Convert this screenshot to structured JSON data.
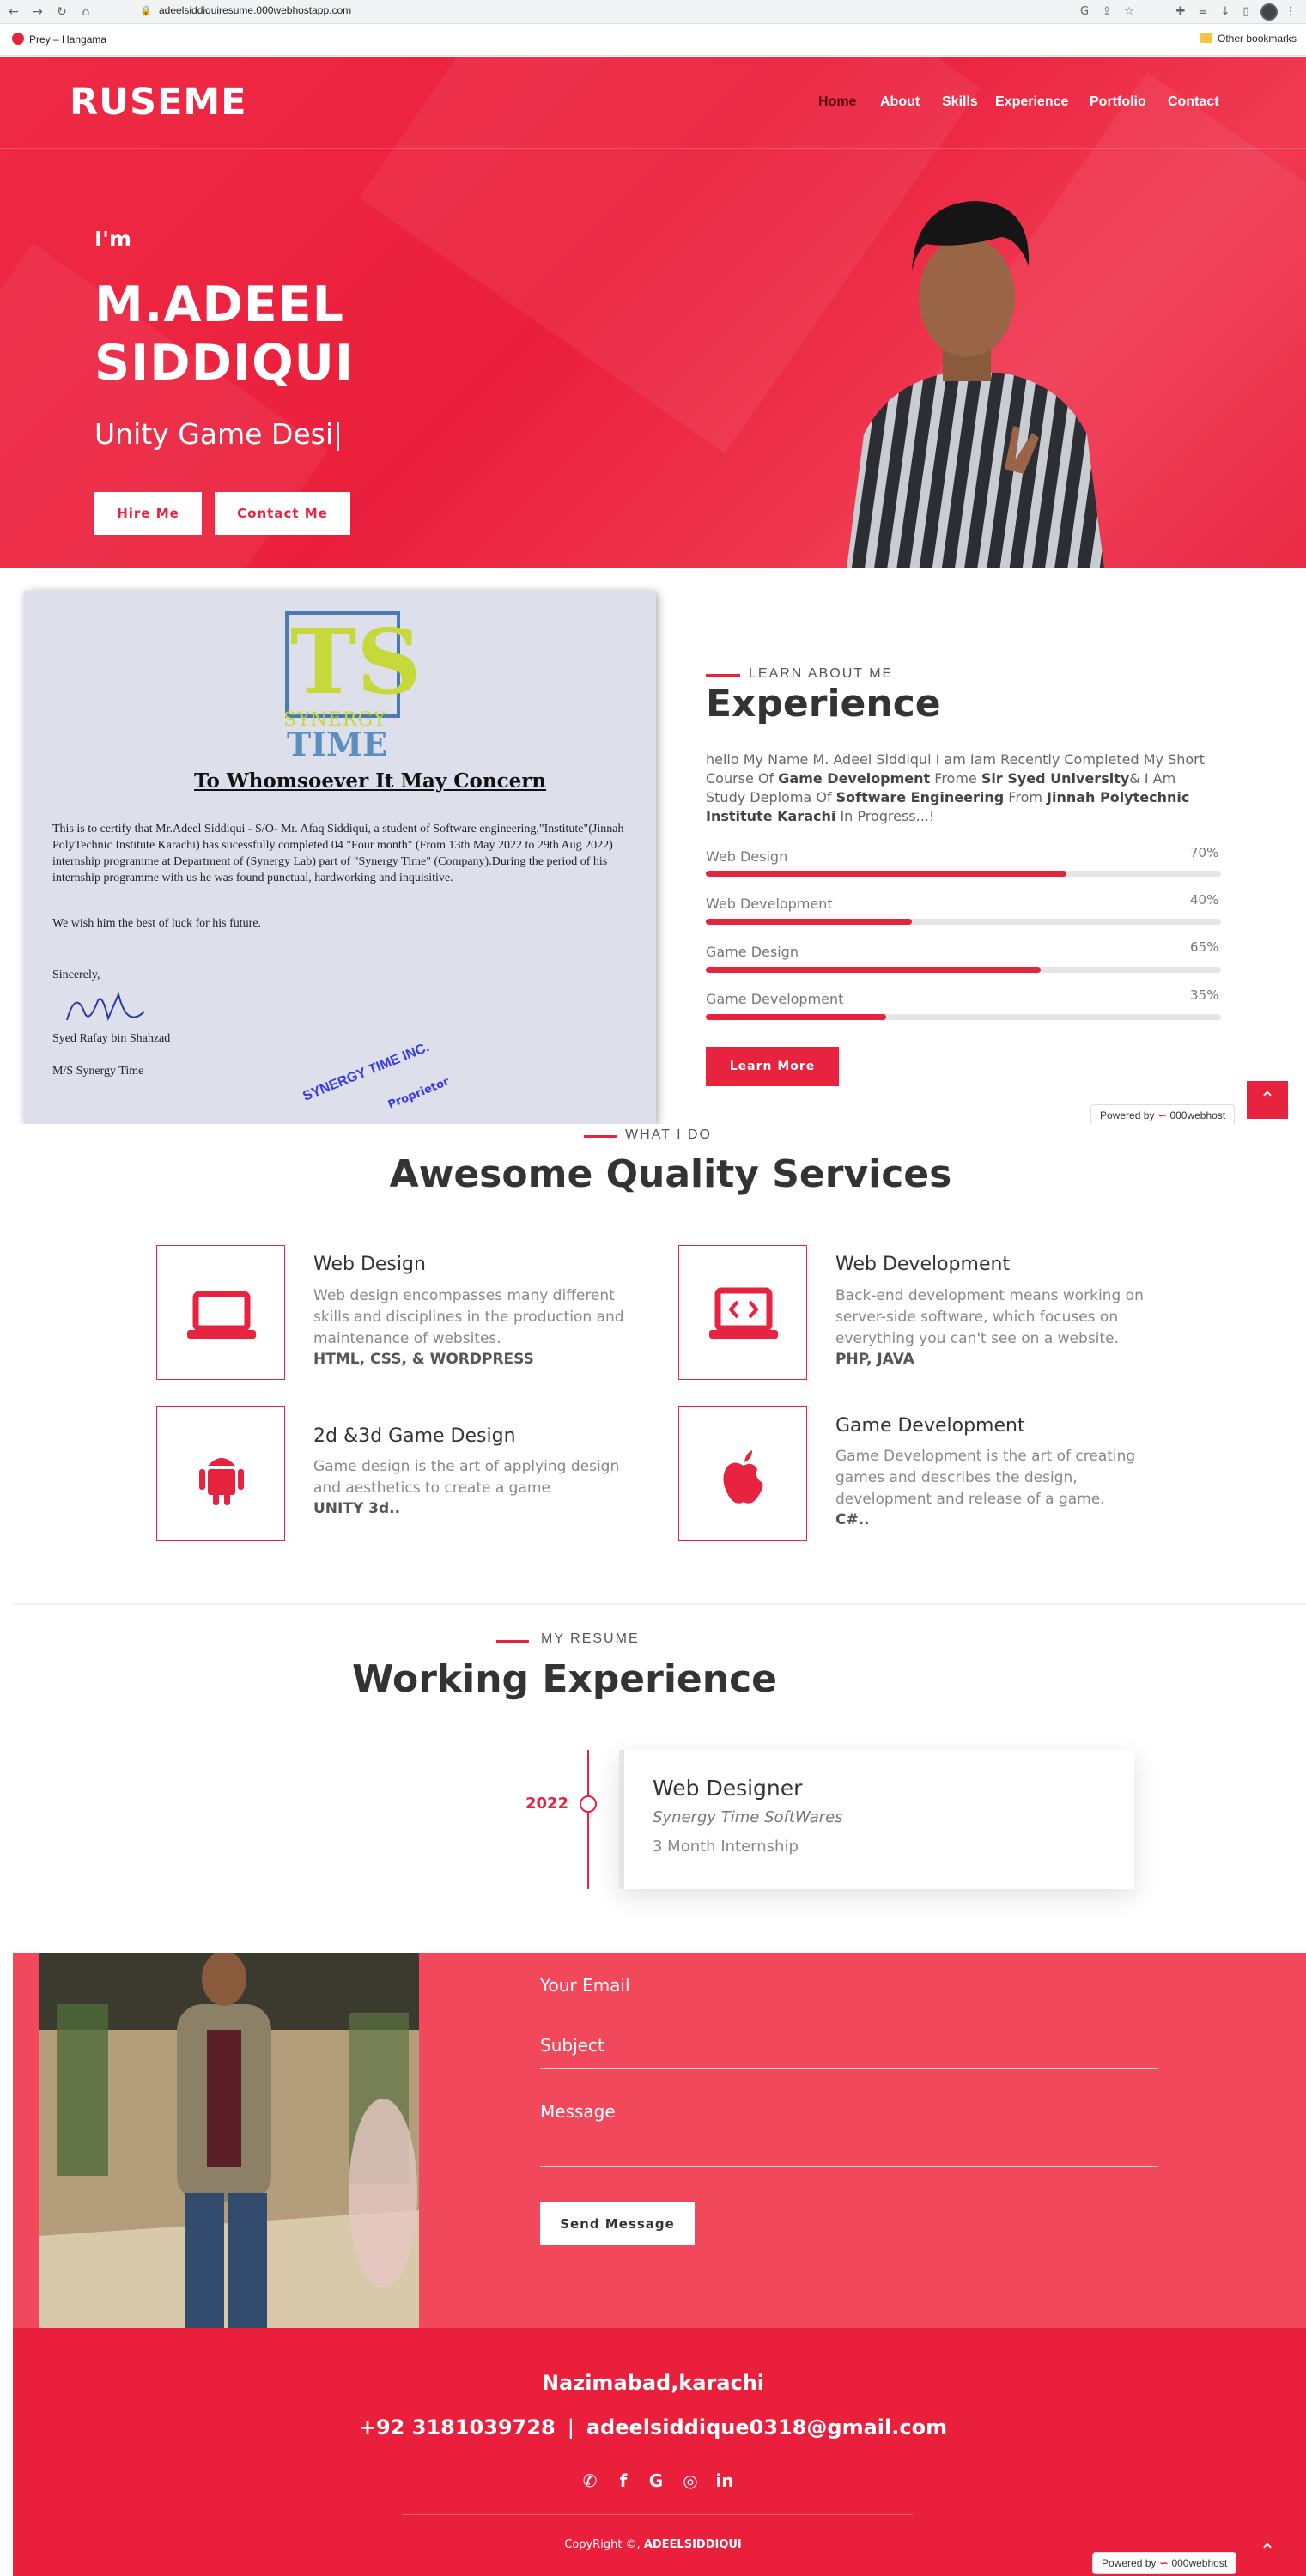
{
  "browser": {
    "url": "adeelsiddiquiresume.000webhostapp.com",
    "bookmark": "Prey – Hangama",
    "other_bookmarks": "Other bookmarks"
  },
  "header": {
    "logo": "RUSEME",
    "nav": [
      "Home",
      "About",
      "Skills",
      "Experience",
      "Portfolio",
      "Contact"
    ],
    "active_nav": "Home"
  },
  "hero": {
    "greeting": "I'm",
    "name_line1": "M.ADEEL",
    "name_line2": "SIDDIQUI",
    "typed_role": "Unity Game Desi|",
    "hire_label": "Hire Me",
    "contact_label": "Contact Me"
  },
  "certificate": {
    "logo_letters": "TS",
    "logo_sub": "SYNERGY",
    "logo_time": "TIME",
    "title": "To Whomsoever It May Concern",
    "body": "This is to certify that Mr.Adeel Siddiqui - S/O- Mr. Afaq Siddiqui, a student of Software engineering,\"Institute\"(Jinnah PolyTechnic Institute Karachi) has sucessfully completed 04 \"Four month\" (From 13th May 2022 to 29th Aug 2022) internship programme at Department of (Synergy Lab) part of \"Synergy Time\" (Company).During the period of his internship programme with us he was found punctual, hardworking and inquisitive.",
    "wish": "We wish him the best of luck for his future.",
    "sincerely": "Sincerely,",
    "signer": "Syed Rafay bin Shahzad",
    "org": "M/S Synergy Time",
    "stamp": "SYNERGY TIME INC.",
    "stamp_sub": "Proprietor"
  },
  "about": {
    "kicker": "LEARN ABOUT ME",
    "heading": "Experience",
    "text_parts": {
      "p1": "hello My Name M. Adeel Siddiqui I am Iam Recently Completed My Short Course Of ",
      "b1": "Game Development",
      "p2": " Frome ",
      "b2": "Sir Syed University",
      "p3": "& I Am Study Deploma Of ",
      "b3": "Software Engineering",
      "p4": " From ",
      "b4": "Jinnah Polytechnic Institute Karachi",
      "p5": " In Progress...!"
    },
    "skills": [
      {
        "name": "Web Design",
        "percent": 70,
        "label": "70%"
      },
      {
        "name": "Web Development",
        "percent": 40,
        "label": "40%"
      },
      {
        "name": "Game Design",
        "percent": 65,
        "label": "65%"
      },
      {
        "name": "Game Development",
        "percent": 35,
        "label": "35%"
      }
    ],
    "learn_more": "Learn More"
  },
  "powered_by": {
    "label": "Powered by",
    "brand": "000webhost"
  },
  "services": {
    "kicker": "WHAT I DO",
    "heading": "Awesome Quality Services",
    "items": [
      {
        "title": "Web Design",
        "desc": "Web design encompasses many different skills and disciplines in the production and maintenance of websites.",
        "tech": "HTML, CSS, & WORDPRESS",
        "icon": "laptop-icon"
      },
      {
        "title": "Web Development",
        "desc": "Back-end development means working on server-side software, which focuses on everything you can't see on a website.",
        "tech": "PHP, JAVA",
        "icon": "laptop-code-icon"
      },
      {
        "title": "2d &3d Game Design",
        "desc": "Game design is the art of applying design and aesthetics to create a game",
        "tech": "UNITY 3d..",
        "icon": "android-icon"
      },
      {
        "title": "Game Development",
        "desc": "Game Development is the art of creating games and describes the design, development and release of a game.",
        "tech": "C#..",
        "icon": "apple-icon"
      }
    ]
  },
  "resume": {
    "kicker": "MY RESUME",
    "heading": "Working Experience",
    "year": "2022",
    "title": "Web Designer",
    "company": "Synergy Time SoftWares",
    "desc": "3 Month Internship"
  },
  "contact": {
    "email_label": "Your Email",
    "subject_label": "Subject",
    "message_label": "Message",
    "send_label": "Send Message"
  },
  "footer": {
    "address": "Nazimabad,karachi",
    "phone": "+92 3181039728",
    "separator": "|",
    "email": "adeelsiddique0318@gmail.com",
    "copyright_prefix": "CopyRight ©, ",
    "copyright_name": "ADEELSIDDIQUI"
  },
  "colors": {
    "accent": "#e8233f",
    "contact_bg": "#f2485c"
  }
}
